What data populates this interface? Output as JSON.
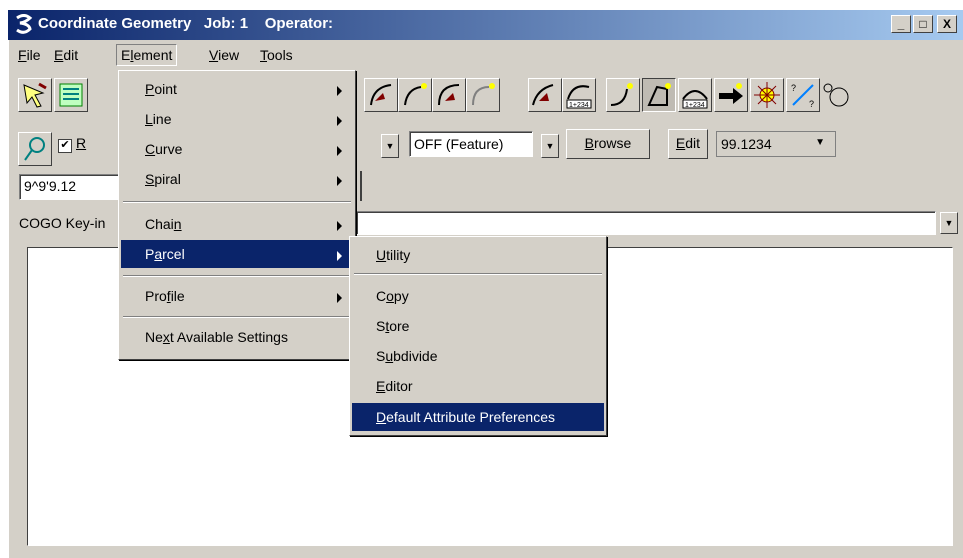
{
  "window": {
    "title": "Coordinate Geometry   Job: 1    Operator:",
    "logo_icon": "cogo-logo-icon",
    "minimize_label": "_",
    "maximize_label": "□",
    "close_label": "X"
  },
  "menubar": {
    "items": [
      {
        "label": "File"
      },
      {
        "label": "Edit"
      },
      {
        "label": "Element"
      },
      {
        "label": "View"
      },
      {
        "label": "Tools"
      }
    ],
    "active": "Element"
  },
  "toolbar": {
    "checkbox_label": "R",
    "checkbox_checked": true,
    "feature_value": "OFF (Feature)",
    "browse_label": "Browse",
    "edit_label": "Edit",
    "number_value": "99.1234",
    "angle_value": "9^9'9.12",
    "keyin_label": "COGO Key-in"
  },
  "element_menu": {
    "items": [
      {
        "label": "Point",
        "submenu": true
      },
      {
        "label": "Line",
        "submenu": true
      },
      {
        "label": "Curve",
        "submenu": true
      },
      {
        "label": "Spiral",
        "submenu": true
      },
      {
        "label": "Chain",
        "submenu": true
      },
      {
        "label": "Parcel",
        "submenu": true,
        "highlighted": true
      },
      {
        "label": "Profile",
        "submenu": true
      },
      {
        "label": "Next Available Settings",
        "submenu": false
      }
    ]
  },
  "parcel_submenu": {
    "items": [
      {
        "label": "Utility"
      },
      {
        "label": "Copy"
      },
      {
        "label": "Store"
      },
      {
        "label": "Subdivide"
      },
      {
        "label": "Editor"
      },
      {
        "label": "Default Attribute Preferences",
        "highlighted": true
      }
    ]
  },
  "colors": {
    "title_start": "#0a246a",
    "title_end": "#a6caf0",
    "highlight": "#0a246a",
    "face": "#d4d0c8"
  }
}
